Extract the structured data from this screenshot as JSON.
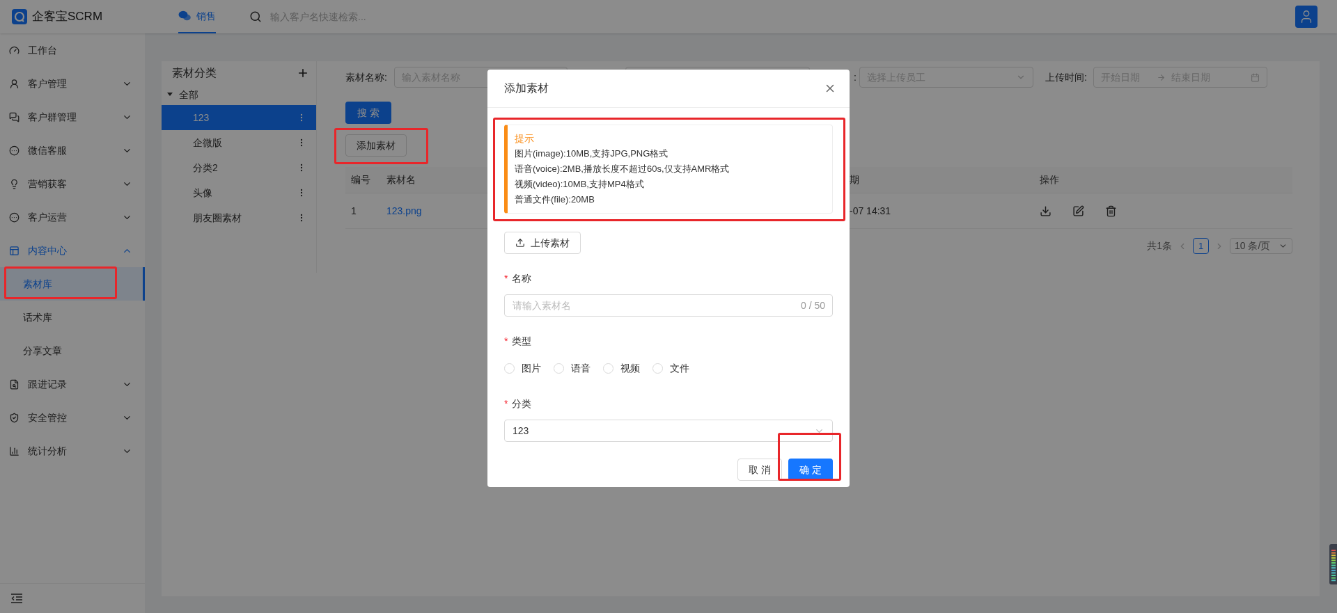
{
  "app": {
    "name": "企客宝SCRM"
  },
  "top_nav": {
    "tabs": [
      {
        "label": "销售",
        "selected": true
      }
    ],
    "search": {
      "placeholder": "输入客户名快速检索..."
    }
  },
  "sidebar": {
    "items": [
      {
        "label": "工作台",
        "kind": "link",
        "selected": false
      },
      {
        "label": "客户管理",
        "kind": "group",
        "selected": false,
        "expanded": false
      },
      {
        "label": "客户群管理",
        "kind": "group",
        "selected": false,
        "expanded": false
      },
      {
        "label": "微信客服",
        "kind": "group",
        "selected": false,
        "expanded": false
      },
      {
        "label": "营销获客",
        "kind": "group",
        "selected": false,
        "expanded": false
      },
      {
        "label": "客户运营",
        "kind": "group",
        "selected": false,
        "expanded": false
      },
      {
        "label": "内容中心",
        "kind": "group",
        "selected": true,
        "expanded": true,
        "children": [
          {
            "label": "素材库",
            "selected": true
          },
          {
            "label": "话术库",
            "selected": false
          },
          {
            "label": "分享文章",
            "selected": false
          }
        ]
      },
      {
        "label": "跟进记录",
        "kind": "group",
        "selected": false,
        "expanded": false
      },
      {
        "label": "安全管控",
        "kind": "group",
        "selected": false,
        "expanded": false
      },
      {
        "label": "统计分析",
        "kind": "group",
        "selected": false,
        "expanded": false
      }
    ]
  },
  "categories": {
    "title": "素材分类",
    "root": {
      "label": "全部",
      "expanded": true,
      "children": [
        {
          "label": "123",
          "selected": true
        },
        {
          "label": "企微版",
          "selected": false
        },
        {
          "label": "分类2",
          "selected": false
        },
        {
          "label": "头像",
          "selected": false
        },
        {
          "label": "朋友圈素材",
          "selected": false
        }
      ]
    }
  },
  "filters": {
    "name": {
      "label": "素材名称:",
      "placeholder": "输入素材名称"
    },
    "uploader": {
      "label": ":",
      "placeholder": "选择上传员工"
    },
    "upload_time": {
      "label": "上传时间:",
      "start_placeholder": "开始日期",
      "end_placeholder": "结束日期"
    }
  },
  "search_button": "搜 索",
  "add_button": "添加素材",
  "table": {
    "columns": [
      "编号",
      "素材名",
      "期",
      "操作"
    ],
    "rows": [
      {
        "cells": [
          "1",
          "123.png",
          "-07 14:31"
        ]
      }
    ]
  },
  "pagination": {
    "total": "共1条",
    "pages": [
      {
        "label": "1",
        "selected": true
      }
    ],
    "page_size": "10 条/页"
  },
  "dialog": {
    "title": "添加素材",
    "notice": {
      "title": "提示",
      "lines": [
        "图片(image):10MB,支持JPG,PNG格式",
        "语音(voice):2MB,播放长度不超过60s,仅支持AMR格式",
        "视频(video):10MB,支持MP4格式",
        "普通文件(file):20MB"
      ]
    },
    "upload_button": "上传素材",
    "fields": [
      {
        "kind": "text",
        "label": "名称",
        "required_mark": "*",
        "placeholder": "请输入素材名",
        "counter": "0 / 50"
      },
      {
        "kind": "radio",
        "label": "类型",
        "required_mark": "*",
        "options": [
          {
            "label": "图片",
            "selected": false
          },
          {
            "label": "语音",
            "selected": false
          },
          {
            "label": "视频",
            "selected": false
          },
          {
            "label": "文件",
            "selected": false
          }
        ]
      },
      {
        "kind": "select",
        "label": "分类",
        "required_mark": "*",
        "value": "123"
      }
    ],
    "buttons": [
      {
        "label": "取 消",
        "kind": "default"
      },
      {
        "label": "确 定",
        "kind": "primary"
      }
    ]
  }
}
